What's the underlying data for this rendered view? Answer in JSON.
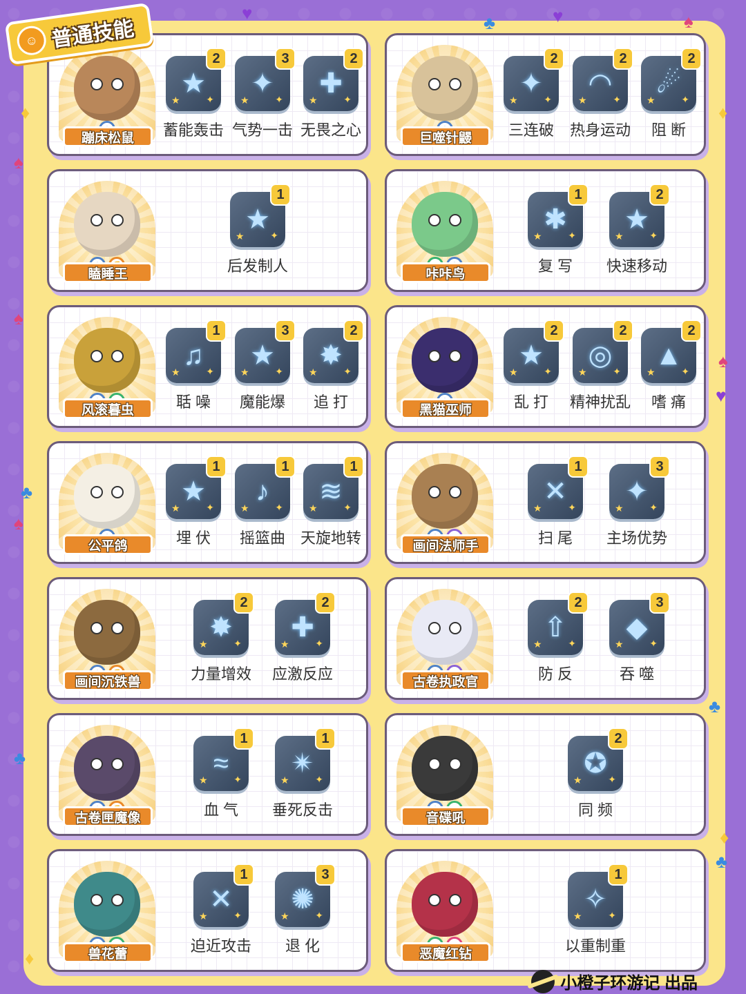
{
  "header": {
    "title": "普通技能",
    "icon": "lightbulb-face-icon"
  },
  "footer": {
    "credit": "小橙子环游记 出品",
    "logo": "planet-logo"
  },
  "colors": {
    "background": "#9a6fd6",
    "frame": "#fbe58a",
    "name_plate": "#e98a2a",
    "badge": "#f7c93a",
    "skill_tile": "#34455c"
  },
  "cards": [
    {
      "name": "蹦床松鼠",
      "attributes": [
        "normal"
      ],
      "skills": [
        {
          "name": "蓄能轰击",
          "cost": "2",
          "icon": "star-burst-icon"
        },
        {
          "name": "气势一击",
          "cost": "3",
          "icon": "impact-icon"
        },
        {
          "name": "无畏之心",
          "cost": "2",
          "icon": "plus-cross-icon"
        }
      ]
    },
    {
      "name": "巨噬针鼹",
      "attributes": [
        "normal"
      ],
      "skills": [
        {
          "name": "三连破",
          "cost": "2",
          "icon": "sparkle-icon"
        },
        {
          "name": "热身运动",
          "cost": "2",
          "icon": "rainbow-icon"
        },
        {
          "name": "阻 断",
          "cost": "2",
          "icon": "comet-icon"
        }
      ]
    },
    {
      "name": "瞌睡王",
      "attributes": [
        "normal",
        "fighting"
      ],
      "skills": [
        {
          "name": "后发制人",
          "cost": "1",
          "icon": "star-icon"
        }
      ]
    },
    {
      "name": "咔咔鸟",
      "attributes": [
        "grass",
        "normal"
      ],
      "skills": [
        {
          "name": "复 写",
          "cost": "1",
          "icon": "anger-mark-icon"
        },
        {
          "name": "快速移动",
          "cost": "2",
          "icon": "dash-star-icon"
        }
      ]
    },
    {
      "name": "风滚暮虫",
      "attributes": [
        "normal",
        "bug"
      ],
      "skills": [
        {
          "name": "聒 噪",
          "cost": "1",
          "icon": "music-note-icon"
        },
        {
          "name": "魔能爆",
          "cost": "3",
          "icon": "big-star-icon"
        },
        {
          "name": "追 打",
          "cost": "2",
          "icon": "burst-icon"
        }
      ]
    },
    {
      "name": "黑猫巫师",
      "attributes": [
        "normal"
      ],
      "skills": [
        {
          "name": "乱 打",
          "cost": "2",
          "icon": "flying-star-icon"
        },
        {
          "name": "精神扰乱",
          "cost": "2",
          "icon": "swirl-icon"
        },
        {
          "name": "嗜 痛",
          "cost": "2",
          "icon": "bell-icon"
        }
      ]
    },
    {
      "name": "公平鸽",
      "attributes": [
        "normal"
      ],
      "skills": [
        {
          "name": "埋 伏",
          "cost": "1",
          "icon": "gold-star-icon"
        },
        {
          "name": "摇篮曲",
          "cost": "1",
          "icon": "lullaby-note-icon"
        },
        {
          "name": "天旋地转",
          "cost": "1",
          "icon": "tornado-icon"
        }
      ]
    },
    {
      "name": "画间法师手",
      "attributes": [
        "normal",
        "psychic"
      ],
      "skills": [
        {
          "name": "扫 尾",
          "cost": "1",
          "icon": "cross-slash-icon"
        },
        {
          "name": "主场优势",
          "cost": "3",
          "icon": "arena-icon"
        }
      ]
    },
    {
      "name": "画间沉铁兽",
      "attributes": [
        "normal",
        "fighting"
      ],
      "skills": [
        {
          "name": "力量增效",
          "cost": "2",
          "icon": "power-burst-icon"
        },
        {
          "name": "应激反应",
          "cost": "2",
          "icon": "plus-cross-icon"
        }
      ]
    },
    {
      "name": "古卷执政官",
      "attributes": [
        "normal",
        "psychic"
      ],
      "skills": [
        {
          "name": "防 反",
          "cost": "2",
          "icon": "up-arrow-icon"
        },
        {
          "name": "吞 噬",
          "cost": "3",
          "icon": "jaws-icon"
        }
      ]
    },
    {
      "name": "古卷匣魔像",
      "attributes": [
        "normal",
        "fighting"
      ],
      "skills": [
        {
          "name": "血 气",
          "cost": "1",
          "icon": "wind-icon"
        },
        {
          "name": "垂死反击",
          "cost": "1",
          "icon": "starburst-icon"
        }
      ]
    },
    {
      "name": "音碟吼",
      "attributes": [
        "normal",
        "grass"
      ],
      "skills": [
        {
          "name": "同 频",
          "cost": "2",
          "icon": "disc-star-icon"
        }
      ]
    },
    {
      "name": "兽花蕾",
      "attributes": [
        "normal",
        "grass"
      ],
      "skills": [
        {
          "name": "迫近攻击",
          "cost": "1",
          "icon": "x-strike-icon"
        },
        {
          "name": "退 化",
          "cost": "3",
          "icon": "shatter-icon"
        }
      ]
    },
    {
      "name": "恶魔红钻",
      "attributes": [
        "grass",
        "demon"
      ],
      "skills": [
        {
          "name": "以重制重",
          "cost": "1",
          "icon": "light-beam-icon"
        }
      ]
    }
  ]
}
